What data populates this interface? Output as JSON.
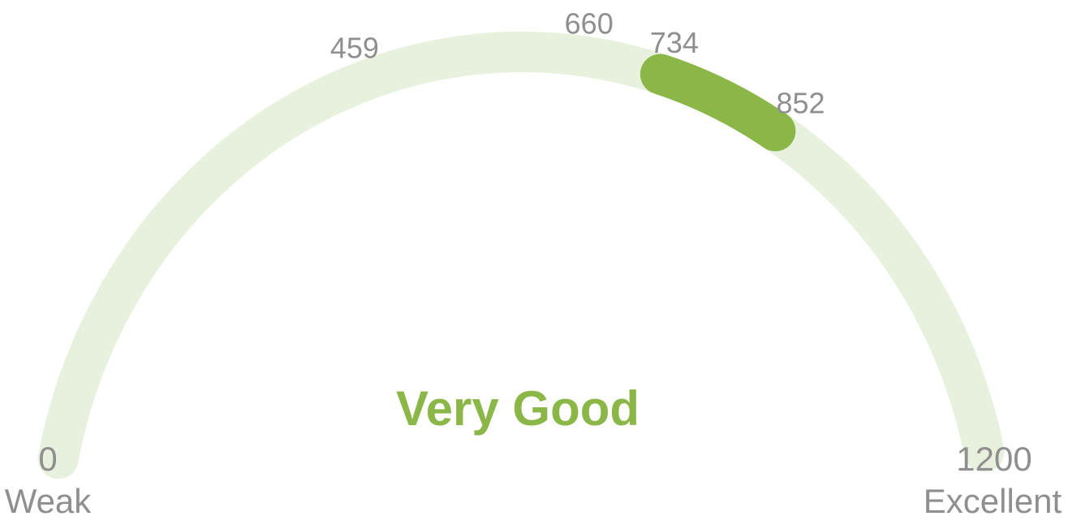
{
  "gauge": {
    "min": 0,
    "max": 1200,
    "range_start": 734,
    "range_end": 852,
    "rating": "Very Good",
    "min_label": "0",
    "max_label": "1200",
    "min_caption": "Weak",
    "max_caption": "Excellent",
    "ticks": [
      {
        "value": 459,
        "label": "459"
      },
      {
        "value": 660,
        "label": "660"
      },
      {
        "value": 734,
        "label": "734"
      },
      {
        "value": 852,
        "label": "852"
      }
    ],
    "colors": {
      "track": "#e8f1dd",
      "fill": "#8bb749",
      "rating": "#8bb749",
      "labels": "#8f8f8f"
    }
  }
}
